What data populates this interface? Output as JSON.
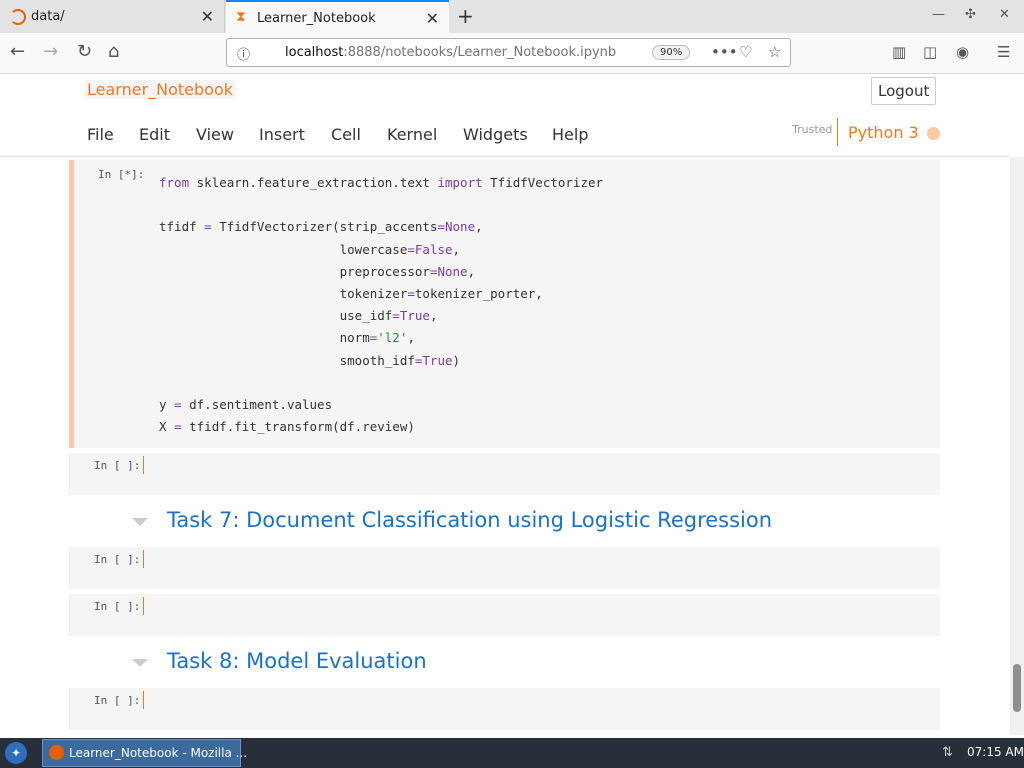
{
  "browser": {
    "tabs": [
      {
        "label": "data/",
        "icon": "firefox-loading-icon"
      },
      {
        "label": "Learner_Notebook",
        "icon": "hourglass-icon"
      }
    ],
    "url_host": "localhost",
    "url_path": ":8888/notebooks/Learner_Notebook.ipynb",
    "zoom": "90%"
  },
  "jupyter": {
    "title": "Learner_Notebook",
    "logout_label": "Logout",
    "menu": [
      "File",
      "Edit",
      "View",
      "Insert",
      "Cell",
      "Kernel",
      "Widgets",
      "Help"
    ],
    "trusted": "Trusted",
    "kernel": "Python 3"
  },
  "cells": [
    {
      "prompt": "In [*]:"
    },
    {
      "prompt": "In [ ]:"
    },
    {
      "prompt": "In [ ]:"
    },
    {
      "prompt": "In [ ]:"
    },
    {
      "prompt": "In [ ]:"
    }
  ],
  "headings": [
    "Task 7: Document Classification using Logistic Regression",
    "Task 8: Model Evaluation"
  ],
  "code": {
    "l1a": "from",
    "l1b": " sklearn.feature_extraction.text ",
    "l1c": "import",
    "l1d": " TfidfVectorizer",
    "l3a": "tfidf ",
    "l3b": "=",
    "l3c": " TfidfVectorizer(strip_accents",
    "l3d": "=",
    "l3e": "None",
    "l3f": ",",
    "l4a": "                        lowercase",
    "l4b": "=",
    "l4c": "False",
    "l4d": ",",
    "l5a": "                        preprocessor",
    "l5b": "=",
    "l5c": "None",
    "l5d": ",",
    "l6a": "                        tokenizer",
    "l6b": "=",
    "l6c": "tokenizer_porter,",
    "l7a": "                        use_idf",
    "l7b": "=",
    "l7c": "True",
    "l7d": ",",
    "l8a": "                        norm",
    "l8b": "=",
    "l8c": "'l2'",
    "l8d": ",",
    "l9a": "                        smooth_idf",
    "l9b": "=",
    "l9c": "True",
    "l9d": ")",
    "l11a": "y ",
    "l11b": "=",
    "l11c": " df.sentiment.values",
    "l12a": "X ",
    "l12b": "=",
    "l12c": " tfidf.fit_transform(df.review)"
  },
  "taskbar": {
    "window_label": "Learner_Notebook - Mozilla ...",
    "clock": "07:15 AM"
  }
}
